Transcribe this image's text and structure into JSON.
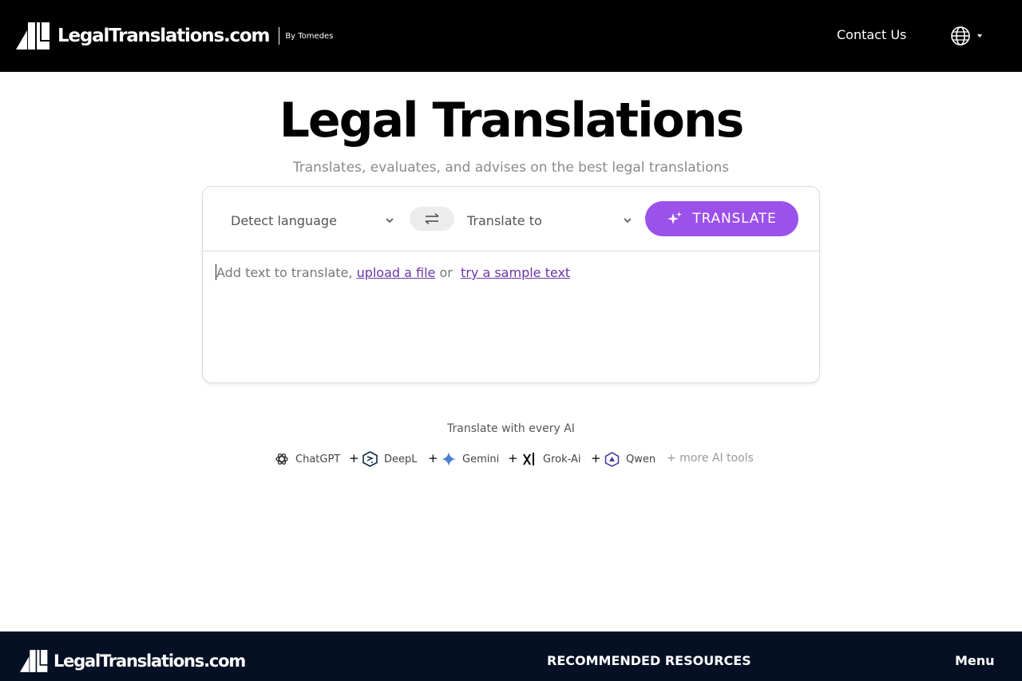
{
  "header": {
    "logo_text": "LegalTranslations.com",
    "logo_by": "By Tomedes",
    "contact_label": "Contact Us",
    "language_icon": "globe-icon"
  },
  "hero": {
    "title": "Legal Translations",
    "subtitle": "Translates, evaluates, and advises on the best legal translations"
  },
  "translator": {
    "source_language": "Detect language",
    "target_language": "Translate to",
    "swap_icon": "swap-arrows-icon",
    "translate_label": "TRANSLATE",
    "input_placeholder": "Add text to translate,",
    "upload_link": "upload a file",
    "or_text": "or",
    "sample_link": "try a sample text"
  },
  "ai_tools": {
    "heading": "Translate with every AI",
    "items": [
      {
        "label": "ChatGPT",
        "icon": "chatgpt-icon"
      },
      {
        "label": "DeepL",
        "icon": "deepl-icon"
      },
      {
        "label": "Gemini",
        "icon": "gemini-icon"
      },
      {
        "label": "Grok-Ai",
        "icon": "grok-icon"
      },
      {
        "label": "Qwen",
        "icon": "qwen-icon"
      }
    ],
    "plus": "+",
    "more": "+ more AI tools"
  },
  "footer": {
    "logo_text": "LegalTranslations.com",
    "resources_label": "RECOMMENDED RESOURCES",
    "menu_label": "Menu"
  },
  "colors": {
    "header_bg": "#000000",
    "accent": "#9b51ea",
    "link": "#6b35a6",
    "footer_bg": "#061024"
  }
}
